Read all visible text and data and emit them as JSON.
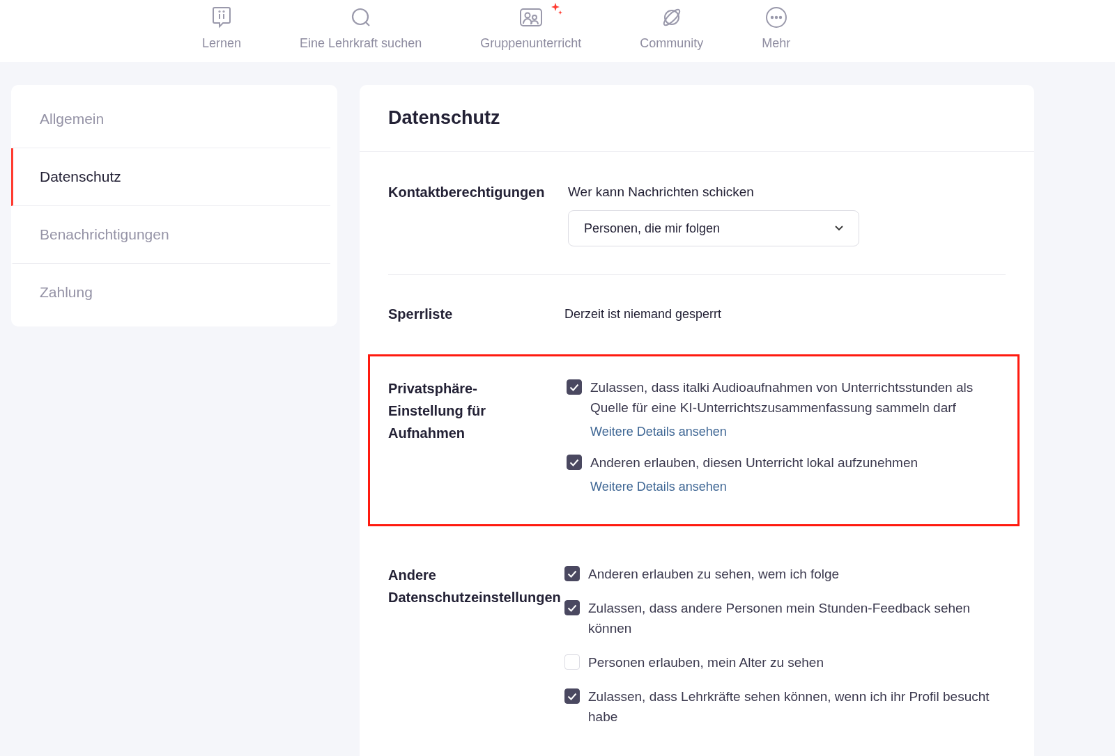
{
  "nav": [
    {
      "label": "Lernen"
    },
    {
      "label": "Eine Lehrkraft suchen"
    },
    {
      "label": "Gruppenunterricht",
      "badge": true
    },
    {
      "label": "Community"
    },
    {
      "label": "Mehr"
    }
  ],
  "sidebar": {
    "items": [
      {
        "label": "Allgemein",
        "selected": false
      },
      {
        "label": "Datenschutz",
        "selected": true
      },
      {
        "label": "Benachrichtigungen",
        "selected": false
      },
      {
        "label": "Zahlung",
        "selected": false
      }
    ]
  },
  "panel": {
    "title": "Datenschutz",
    "sections": [
      {
        "kind": "select",
        "label": "Kontaktberechtigungen",
        "caption": "Wer kann Nachrichten schicken",
        "value": "Personen, die mir folgen",
        "highlighted": false
      },
      {
        "kind": "text",
        "label": "Sperrliste",
        "text": "Derzeit ist niemand gesperrt",
        "highlighted": false
      },
      {
        "kind": "checkboxes",
        "label": "Privatsphäre-Einstellung für Aufnahmen",
        "highlighted": true,
        "items": [
          {
            "text": "Zulassen, dass italki Audioaufnahmen von Unterrichtsstunden als Quelle für eine KI-Unterrichtszusammenfassung sammeln darf",
            "checked": true,
            "link": "Weitere Details ansehen"
          },
          {
            "text": "Anderen erlauben, diesen Unterricht lokal aufzunehmen",
            "checked": true,
            "link": "Weitere Details ansehen"
          }
        ]
      },
      {
        "kind": "checkboxes-inline",
        "label": "Andere Datenschutzeinstellungen",
        "highlighted": false,
        "items": [
          {
            "text": "Anderen erlauben zu sehen, wem ich folge",
            "checked": true
          },
          {
            "text": "Zulassen, dass andere Personen mein Stunden-Feedback sehen können",
            "checked": true
          },
          {
            "text": "Personen erlauben, mein Alter zu sehen",
            "checked": false
          },
          {
            "text": "Zulassen, dass Lehrkräfte sehen können, wenn ich ihr Profil besucht habe",
            "checked": true
          }
        ]
      }
    ]
  }
}
